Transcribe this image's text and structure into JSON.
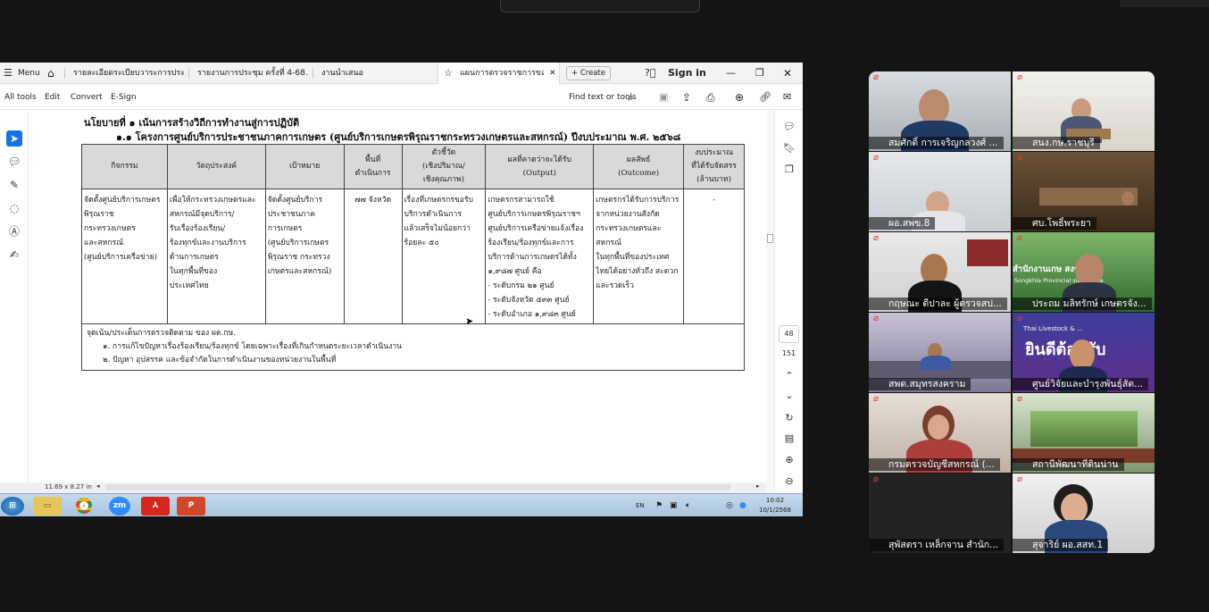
{
  "browser": {
    "menu_label": "Menu",
    "tabs": [
      {
        "label": "รายละเอียดระเบียบวาระการประชุ..."
      },
      {
        "label": "รายงานการประชุม ครั้งที่ 4-68.p..."
      },
      {
        "label": "งานนำเสนอ"
      },
      {
        "label": "แผนการตรวจราชการขอ...",
        "active": true
      }
    ],
    "new_tab_label": "Create",
    "sign_in_label": "Sign in"
  },
  "toolbar": {
    "all_tools": "All tools",
    "edit": "Edit",
    "convert": "Convert",
    "esign": "E-Sign",
    "find": "Find text or tools"
  },
  "document": {
    "policy_heading": "นโยบายที่ ๑ เน้นการสร้างวิถีการทำงานสู่การปฏิบัติ",
    "project_heading": "๑.๑ โครงการศูนย์บริการประชาชนภาคการเกษตร (ศูนย์บริการเกษตรพิรุณราชกระทรวงเกษตรและสหกรณ์) ปีงบประมาณ พ.ศ. ๒๕๖๘",
    "headers": [
      [
        "กิจกรรม"
      ],
      [
        "วัตถุประสงค์"
      ],
      [
        "เป้าหมาย"
      ],
      [
        "พื้นที่",
        "ดำเนินการ"
      ],
      [
        "ตัวชี้วัด",
        "(เชิงปริมาณ/",
        "เชิงคุณภาพ)"
      ],
      [
        "ผลที่คาดว่าจะได้รับ",
        "(Output)"
      ],
      [
        "ผลลัพธ์",
        "(Outcome)"
      ],
      [
        "งบประมาณ",
        "ที่ได้รับจัดสรร",
        "(ล้านบาท)"
      ]
    ],
    "row": [
      [
        "จัดตั้งศูนย์บริการเกษตร",
        "พิรุณราช",
        "กระทรวงเกษตร",
        "และสหกรณ์",
        "(ศูนย์บริการเครือข่าย)"
      ],
      [
        "เพื่อให้กระทรวงเกษตรและ",
        "สหกรณ์มีจุดบริการ/",
        "รับเรื่องร้องเรียน/",
        "ร้องทุกข์และงานบริการ",
        "ด้านการเกษตร",
        "ในทุกพื้นที่ของ",
        "ประเทศไทย"
      ],
      [
        "จัดตั้งศูนย์บริการ",
        "ประชาชนภาค",
        "การเกษตร",
        "(ศูนย์บริการเกษตร",
        "พิรุณราช กระทรวง",
        "เกษตรและสหกรณ์)"
      ],
      [
        "๗๗ จังหวัด"
      ],
      [
        "เรื่องที่เกษตรกรขอรับ",
        "บริการดำเนินการ",
        "แล้วเสร็จไม่น้อยกว่า",
        "ร้อยละ ๕๐"
      ],
      [
        "เกษตรกรสามารถใช้",
        "ศูนย์บริการเกษตรพิรุณราชฯ",
        "ศูนย์บริการเครือข่ายแจ้งเรื่อง",
        "ร้องเรียน/ร้องทุกข์และการ",
        "บริการด้านการเกษตรได้ทั้ง",
        "๑,๙๘๗ ศูนย์ คือ",
        "- ระดับกรม ๒๑ ศูนย์",
        "- ระดับจังหวัด ๕๓๓ ศูนย์",
        "- ระดับอำเภอ ๑,๙๘๓ ศูนย์"
      ],
      [
        "เกษตรกรได้รับการบริการ",
        "จากหน่วยงานสังกัด",
        "กระทรวงเกษตรและ",
        "สหกรณ์",
        "ในทุกพื้นที่ของประเทศ",
        "ไทยได้อย่างทั่วถึง สะดวก",
        "และรวดเร็ว"
      ],
      [
        "-"
      ]
    ],
    "notes_title": "จุดเน้น/ประเด็นการตรวจติดตาม ของ ผต.กษ.",
    "notes": [
      "๑. การแก้ไขปัญหาเรื่องร้องเรียน/ร้องทุกข์ โดยเฉพาะเรื่องที่เกินกำหนดระยะเวลาดำเนินงาน",
      "๒. ปัญหา อุปสรรค และข้อจำกัดในการดำเนินงานของหน่วยงานในพื้นที่"
    ],
    "page_size": "11.69 x 8.27 in",
    "current_page": "48",
    "total_pages": "151"
  },
  "taskbar": {
    "lang": "EN",
    "time": "10:02",
    "date": "10/1/2568",
    "apps": [
      "start",
      "explorer",
      "chrome",
      "zoom",
      "acrobat",
      "powerpoint"
    ]
  },
  "participants": [
    {
      "name": "สมศักดิ์ การเจริญกลวงศ์ ..."
    },
    {
      "name": "สนง.กษ.ราชบุรี"
    },
    {
      "name": "ผอ.สพข.8"
    },
    {
      "name": "ศบ.โพธิ์พระยา"
    },
    {
      "name": "กฤษณะ ดีปาละ ผู้ตรวจสป..."
    },
    {
      "name": "ประถม มลิทรักษ์ เกษตรจัง..."
    },
    {
      "name": "สพด.สมุทรสงคราม"
    },
    {
      "name": "ศูนย์วิจัยและบำรุงพันธุ์สัต..."
    },
    {
      "name": "กรมตรวจบัญชีสหกรณ์ (..."
    },
    {
      "name": "สถานีพัฒนาที่ดินน่าน"
    },
    {
      "name": "สุพัสตรา เหล็กจาน สำนัก..."
    },
    {
      "name": "สุจาริย์ ผอ.สสท.1"
    }
  ],
  "tile_text": {
    "songkhla_office": "สำนักงานเกษ  สงขลา",
    "songkhla_en": "Songkhla Provincial  sion Office",
    "banner_top": "Thai Livestock & ...",
    "banner_main": "ยินดีต้อนรับ"
  },
  "colors": {
    "accent": "#1473e6",
    "mute_red": "#e53935",
    "acrobat_red": "#d7261d",
    "zoom_blue": "#2d8cff"
  }
}
